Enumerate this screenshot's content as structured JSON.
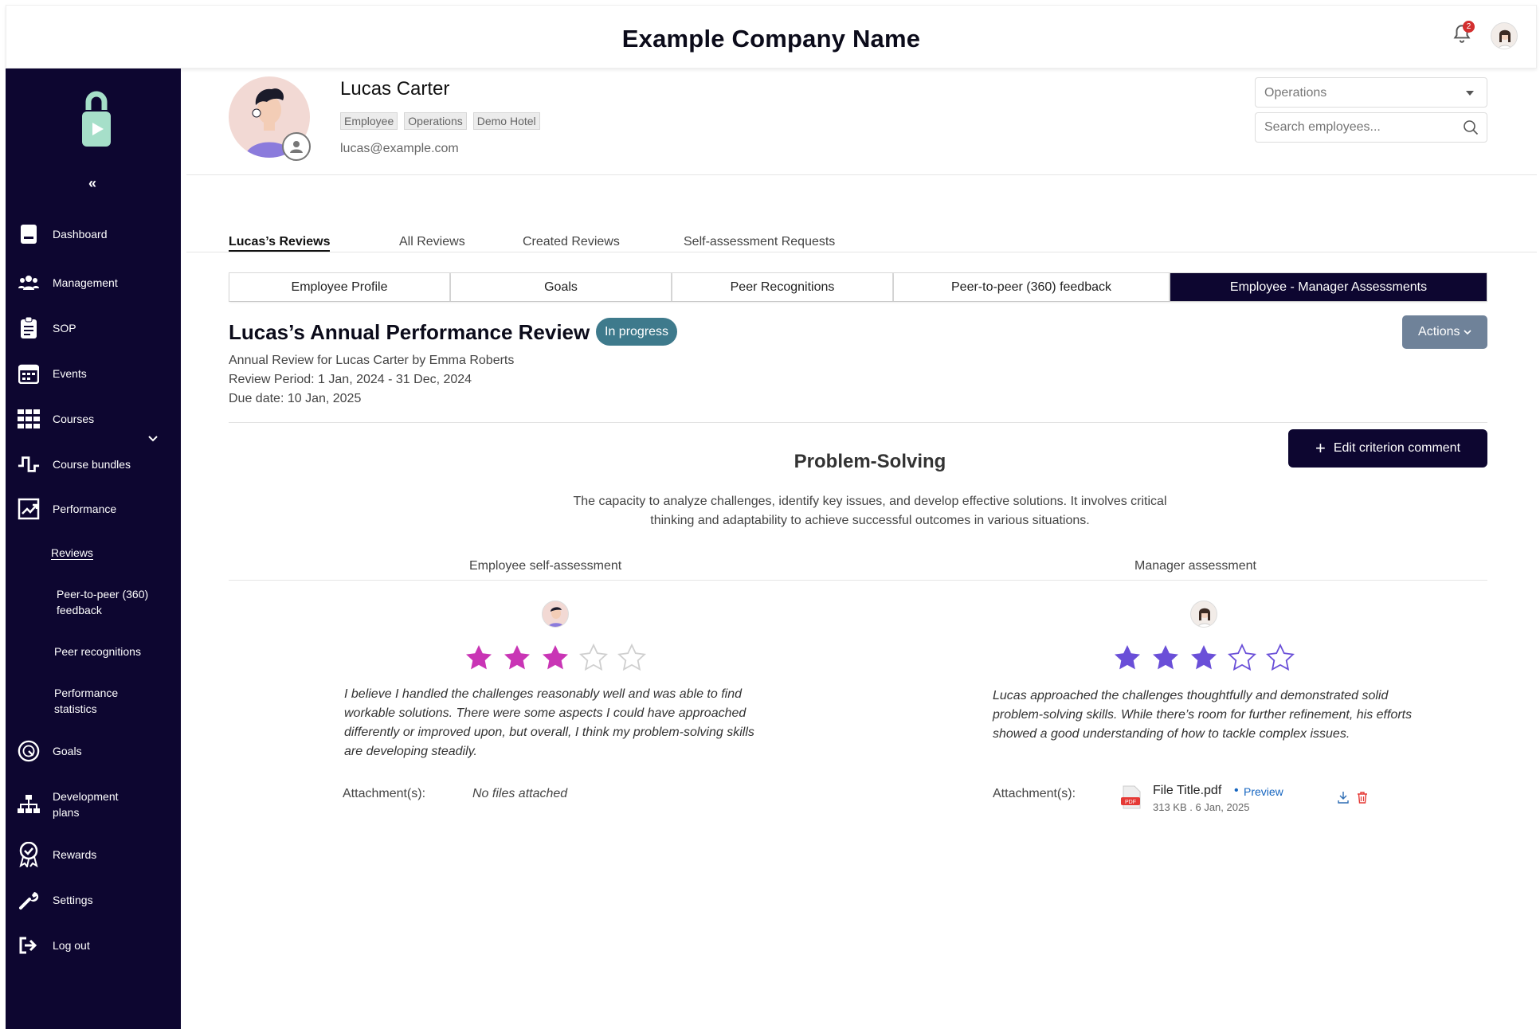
{
  "header": {
    "company_name": "Example Company Name",
    "notification_count": "2"
  },
  "sidebar": {
    "collapse_label": "«",
    "items": [
      {
        "label": "Dashboard",
        "icon": "dashboard-icon"
      },
      {
        "label": "Management",
        "icon": "people-icon"
      },
      {
        "label": "SOP",
        "icon": "clipboard-icon"
      },
      {
        "label": "Events",
        "icon": "calendar-icon"
      },
      {
        "label": "Courses",
        "icon": "grid-icon"
      },
      {
        "label": "Course bundles",
        "icon": "bundle-icon"
      },
      {
        "label": "Performance",
        "icon": "chart-icon"
      },
      {
        "label": "Goals",
        "icon": "target-icon"
      },
      {
        "label": "Development plans",
        "icon": "org-chart-icon"
      },
      {
        "label": "Rewards",
        "icon": "award-icon"
      },
      {
        "label": "Settings",
        "icon": "wrench-icon"
      },
      {
        "label": "Log out",
        "icon": "logout-icon"
      }
    ],
    "performance_sub": [
      {
        "label": "Reviews"
      },
      {
        "label": "Peer-to-peer (360) feedback"
      },
      {
        "label": "Peer recognitions"
      },
      {
        "label": "Performance statistics"
      }
    ]
  },
  "profile": {
    "name": "Lucas Carter",
    "chips": [
      "Employee",
      "Operations",
      "Demo Hotel"
    ],
    "email": "lucas@example.com"
  },
  "filters": {
    "department": "Operations",
    "search_placeholder": "Search employees..."
  },
  "review_tabs": [
    "Lucas’s Reviews",
    "All Reviews",
    "Created Reviews",
    "Self-assessment Requests"
  ],
  "section_tabs": [
    "Employee Profile",
    "Goals",
    "Peer Recognitions",
    "Peer-to-peer (360) feedback",
    "Employee - Manager Assessments"
  ],
  "review": {
    "title": "Lucas’s Annual Performance Review",
    "status": "In progress",
    "actions_label": "Actions",
    "subtitle": "Annual Review for Lucas Carter by Emma Roberts",
    "period": "Review Period: 1 Jan, 2024 - 31 Dec, 2024",
    "due": "Due date: 10 Jan, 2025",
    "edit_label": "Edit criterion comment"
  },
  "criterion": {
    "title": "Problem-Solving",
    "description": "The capacity to analyze challenges, identify key issues, and develop effective solutions. It involves critical thinking and adaptability to achieve successful outcomes in various situations."
  },
  "self_assessment": {
    "heading": "Employee self-assessment",
    "rating": 3,
    "max_rating": 5,
    "star_color": "#c935b5",
    "comment": "I believe I handled the challenges reasonably well and was able to find workable solutions. There were some aspects I could have approached differently or improved upon, but overall, I think my problem-solving skills are developing steadily.",
    "attachments_label": "Attachment(s):",
    "no_files": "No files attached"
  },
  "manager_assessment": {
    "heading": "Manager assessment",
    "rating": 3,
    "max_rating": 5,
    "star_color": "#6a4fd8",
    "comment": "Lucas approached the challenges thoughtfully and demonstrated solid problem-solving skills. While there’s room for further refinement, his efforts showed a good understanding of how to tackle complex issues.",
    "attachments_label": "Attachment(s):",
    "file": {
      "name": "File Title.pdf",
      "separator": "•",
      "preview_label": "Preview",
      "meta": "313 KB . 6 Jan, 2025"
    }
  },
  "colors": {
    "sidebar_bg": "#0d0630",
    "status_badge": "#3e7a8c",
    "actions_button": "#6f8299",
    "link": "#1565c0"
  }
}
